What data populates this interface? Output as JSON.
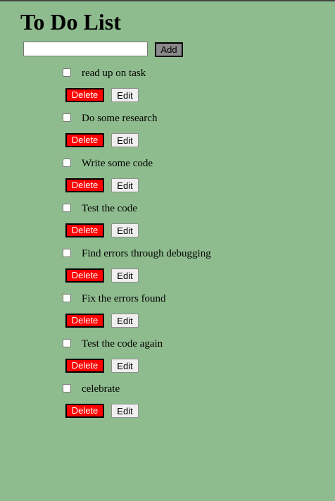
{
  "header": {
    "title": "To Do List"
  },
  "new_task": {
    "value": "",
    "placeholder": "",
    "add_label": "Add"
  },
  "tasks": [
    {
      "text": "read up on task",
      "checked": false,
      "delete_label": "Delete",
      "edit_label": "Edit"
    },
    {
      "text": "Do some research",
      "checked": false,
      "delete_label": "Delete",
      "edit_label": "Edit"
    },
    {
      "text": "Write some code",
      "checked": false,
      "delete_label": "Delete",
      "edit_label": "Edit"
    },
    {
      "text": "Test the code",
      "checked": false,
      "delete_label": "Delete",
      "edit_label": "Edit"
    },
    {
      "text": "Find errors through debugging",
      "checked": false,
      "delete_label": "Delete",
      "edit_label": "Edit"
    },
    {
      "text": "Fix the errors found",
      "checked": false,
      "delete_label": "Delete",
      "edit_label": "Edit"
    },
    {
      "text": "Test the code again",
      "checked": false,
      "delete_label": "Delete",
      "edit_label": "Edit"
    },
    {
      "text": "celebrate",
      "checked": false,
      "delete_label": "Delete",
      "edit_label": "Edit"
    }
  ],
  "colors": {
    "background": "#8fbc8f",
    "delete_button": "#ff0000",
    "add_button": "#8a8a8a",
    "edit_button": "#efefef"
  }
}
